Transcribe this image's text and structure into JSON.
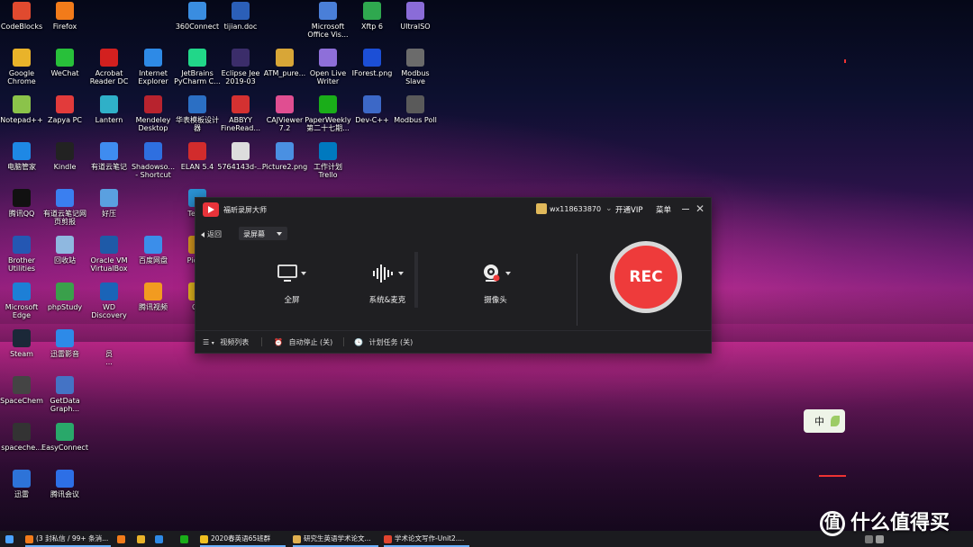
{
  "desktop": {
    "icons": [
      {
        "label": "CodeBlocks",
        "color": "#e04a2f"
      },
      {
        "label": "Firefox",
        "color": "#f27b1a"
      },
      {
        "label": "360Connect",
        "color": "#3a8de0"
      },
      {
        "label": "tijian.doc",
        "color": "#2b5fb8"
      },
      {
        "label": "Microsoft\nOffice Vis...",
        "color": "#4a7fd8"
      },
      {
        "label": "Xftp 6",
        "color": "#2fa84f"
      },
      {
        "label": "UltraISO",
        "color": "#8a6cd8"
      },
      {
        "label": "Google\nChrome",
        "color": "#e9b32a"
      },
      {
        "label": "WeChat",
        "color": "#28c03a"
      },
      {
        "label": "Acrobat\nReader DC",
        "color": "#d3201f"
      },
      {
        "label": "Internet\nExplorer",
        "color": "#2e8ae6"
      },
      {
        "label": "JetBrains\nPyCharm C...",
        "color": "#21d789"
      },
      {
        "label": "Eclipse Jee\n2019-03",
        "color": "#3b2d6a"
      },
      {
        "label": "ATM_pure...",
        "color": "#d8a637"
      },
      {
        "label": "Open Live\nWriter",
        "color": "#8e6fd9"
      },
      {
        "label": "IForest.png",
        "color": "#1c4fd6"
      },
      {
        "label": "Modbus\nSlave",
        "color": "#6b6b6b"
      },
      {
        "label": "Notepad++",
        "color": "#8bc34a"
      },
      {
        "label": "Zapya PC",
        "color": "#e23b3b"
      },
      {
        "label": "Lantern",
        "color": "#2fb0c8"
      },
      {
        "label": "Mendeley\nDesktop",
        "color": "#b8232e"
      },
      {
        "label": "华表模板设计\n器",
        "color": "#2b6fc4"
      },
      {
        "label": "ABBYY\nFineRead...",
        "color": "#d43131"
      },
      {
        "label": "CAJViewer\n7.2",
        "color": "#e04e91"
      },
      {
        "label": "PaperWeekly\n第二十七期...",
        "color": "#1aad19"
      },
      {
        "label": "Dev-C++",
        "color": "#3c68c7"
      },
      {
        "label": "Modbus Poll",
        "color": "#5a5a5a"
      },
      {
        "label": "电脑管家",
        "color": "#1e88e5"
      },
      {
        "label": "Kindle",
        "color": "#222222"
      },
      {
        "label": "有道云笔记",
        "color": "#3f8cf0"
      },
      {
        "label": "Shadowso...\n- Shortcut",
        "color": "#2e6fe0"
      },
      {
        "label": "ELAN 5.4",
        "color": "#d22c2c"
      },
      {
        "label": "5764143d-...",
        "color": "#dddddd"
      },
      {
        "label": "Picture2.png",
        "color": "#4a90e2"
      },
      {
        "label": "工作计划\nTrello",
        "color": "#0079bf"
      },
      {
        "label": "腾讯QQ",
        "color": "#111111"
      },
      {
        "label": "有道云笔记网\n页剪报",
        "color": "#3a7ff0"
      },
      {
        "label": "好压",
        "color": "#5aa0e0"
      },
      {
        "label": "Team",
        "color": "#2a93d5"
      },
      {
        "label": "Brother\nUtilities",
        "color": "#2457b3"
      },
      {
        "label": "回收站",
        "color": "#8fb8e0"
      },
      {
        "label": "Oracle VM\nVirtualBox",
        "color": "#1e5aa8"
      },
      {
        "label": "百度网盘",
        "color": "#3b8eea"
      },
      {
        "label": "Pictur",
        "color": "#e0a020"
      },
      {
        "label": "Microsoft\nEdge",
        "color": "#1d7fd6"
      },
      {
        "label": "phpStudy",
        "color": "#3aa04b"
      },
      {
        "label": "WD\nDiscovery",
        "color": "#1a64b8"
      },
      {
        "label": "腾讯视频",
        "color": "#f29b20"
      },
      {
        "label": "QC",
        "color": "#f0c020"
      },
      {
        "label": "Steam",
        "color": "#1b2838"
      },
      {
        "label": "迅雷影音",
        "color": "#2d8ae8"
      },
      {
        "label": "员\n...",
        "color": "#00000000"
      },
      {
        "label": "SpaceChem",
        "color": "#444444"
      },
      {
        "label": "GetData\nGraph...",
        "color": "#4473c5"
      },
      {
        "label": "spaceche...",
        "color": "#333333"
      },
      {
        "label": "EasyConnect",
        "color": "#29a86a"
      },
      {
        "label": "迅雷",
        "color": "#2d73d8"
      },
      {
        "label": "腾讯会议",
        "color": "#2d6fe6"
      }
    ]
  },
  "recorder": {
    "app_title": "福昕录屏大师",
    "username": "wx118633870",
    "vip_label": "开通VIP",
    "menu_label": "菜单",
    "back_label": "返回",
    "mode_value": "录屏幕",
    "options": {
      "fullscreen": "全屏",
      "audio": "系统&麦克",
      "camera": "摄像头"
    },
    "rec_label": "REC",
    "footer": {
      "video_list": "视频列表",
      "auto_stop": "自动停止 (关)",
      "schedule": "计划任务 (关)"
    },
    "colors": {
      "accent": "#ee3b3b",
      "window_bg": "#1f1f22"
    }
  },
  "ime": {
    "label": "中"
  },
  "taskbar": {
    "items": [
      {
        "label": "(3 封私信 / 99+ 条消...",
        "color": "#f27b1a"
      },
      {
        "label": "",
        "color": "#f27b1a"
      },
      {
        "label": "",
        "color": "#e9b32a"
      },
      {
        "label": "",
        "color": "#2e8ae6"
      },
      {
        "label": "",
        "color": "#1aad19"
      },
      {
        "label": "",
        "color": "#dddddd"
      },
      {
        "label": "2020春英语65班群",
        "color": "#f0c020"
      },
      {
        "label": "研究生英语学术论文...",
        "color": "#e0b050"
      },
      {
        "label": "学术论文写作-Unit2....",
        "color": "#e0442f"
      }
    ]
  },
  "watermark": {
    "symbol": "值",
    "text": "什么值得买"
  }
}
